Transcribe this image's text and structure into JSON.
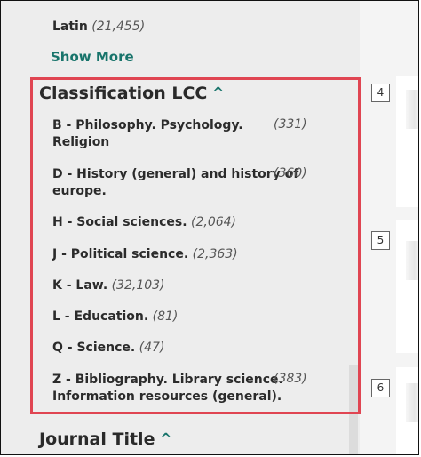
{
  "language": {
    "label": "Latin",
    "count": "(21,455)"
  },
  "show_more": "Show More",
  "classification": {
    "title": "Classification LCC",
    "items": [
      {
        "line1": "B - Philosophy. Psychology.",
        "line2": "Religion",
        "count": "(331)"
      },
      {
        "line1": "D - History (general) and history of",
        "line2": "europe.",
        "count": "(360)"
      },
      {
        "line1": "H - Social sciences.",
        "count": "(2,064)"
      },
      {
        "line1": "J - Political science.",
        "count": "(2,363)"
      },
      {
        "line1": "K - Law.",
        "count": "(32,103)"
      },
      {
        "line1": "L - Education.",
        "count": "(81)"
      },
      {
        "line1": "Q - Science.",
        "count": "(47)"
      },
      {
        "line1": "Z - Bibliography. Library science.",
        "line2": "Information resources (general).",
        "count": "(383)"
      }
    ]
  },
  "journal": {
    "title": "Journal Title"
  },
  "results": [
    "4",
    "5",
    "6"
  ],
  "colors": {
    "accent": "#18746b",
    "highlight": "#e04552"
  }
}
